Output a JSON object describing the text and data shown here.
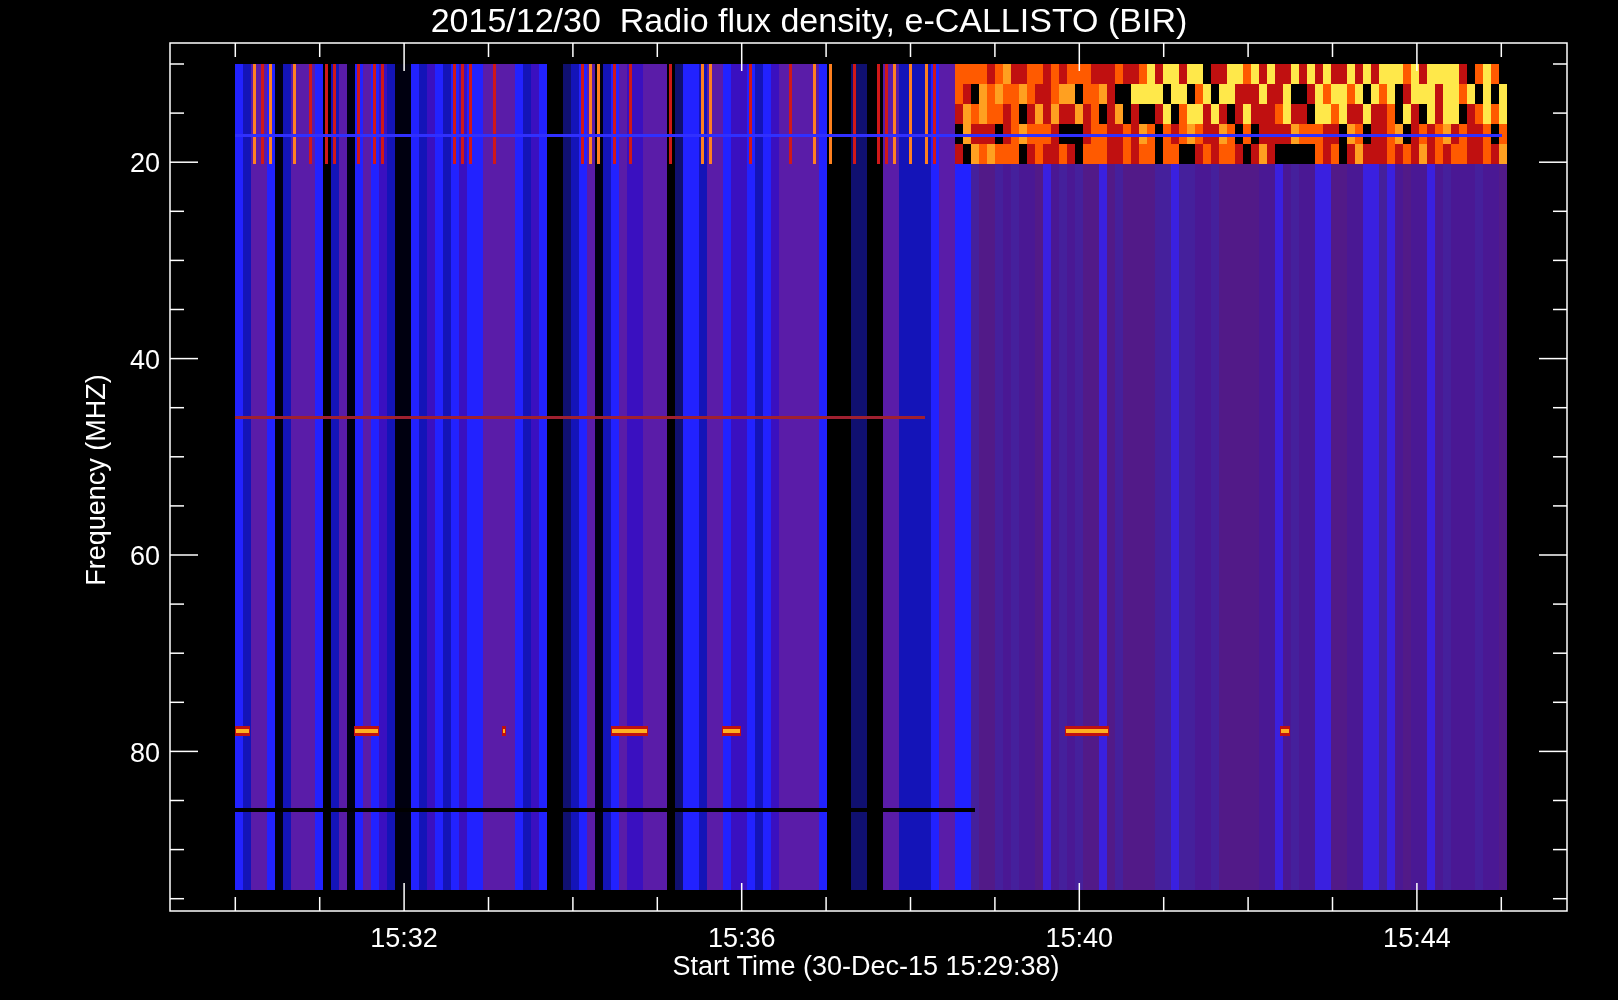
{
  "chart": {
    "title": "2015/12/30  Radio flux density, e-CALLISTO (BIR)",
    "y_axis": {
      "label": "Frequency (MHZ)",
      "ticks": [
        "20",
        "40",
        "60",
        "80"
      ]
    },
    "x_axis": {
      "label": "Start Time (30-Dec-15 15:29:38)",
      "ticks": [
        "15:32",
        "15:36",
        "15:40",
        "15:44"
      ]
    }
  }
}
